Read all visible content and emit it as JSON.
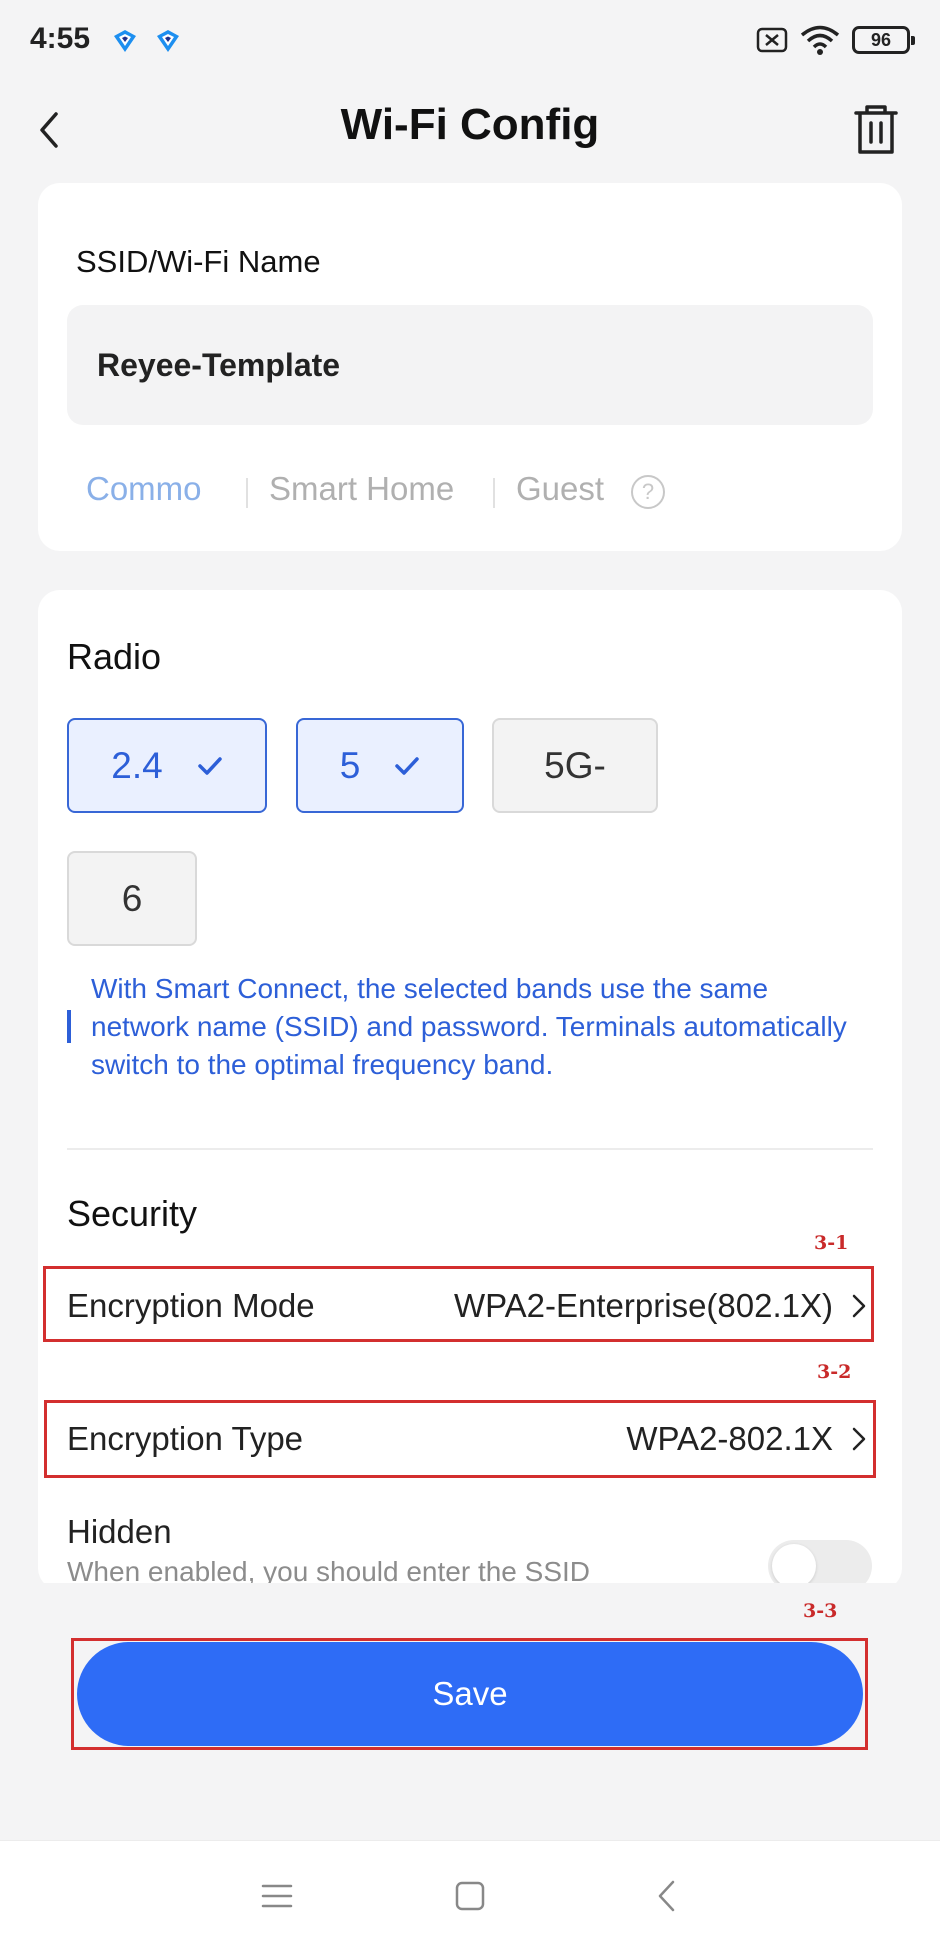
{
  "status_bar": {
    "time": "4:55",
    "battery": "96",
    "icons": [
      "app-notification-icon",
      "app-notification-icon",
      "sim-off-icon",
      "wifi-icon",
      "battery-icon"
    ]
  },
  "header": {
    "title": "Wi-Fi Config",
    "back_icon": "chevron-left-icon",
    "delete_icon": "trash-icon"
  },
  "ssid": {
    "label": "SSID/Wi-Fi Name",
    "value": "Reyee-Template",
    "types": [
      {
        "label": "Commo",
        "active": true
      },
      {
        "label": "Smart Home",
        "active": false
      },
      {
        "label": "Guest",
        "active": false
      }
    ],
    "help_icon": "?"
  },
  "radio": {
    "title": "Radio",
    "bands": [
      {
        "label": "2.4",
        "selected": true
      },
      {
        "label": "5",
        "selected": true
      },
      {
        "label": "5G-",
        "selected": false
      },
      {
        "label": "6",
        "selected": false
      }
    ],
    "hint": "With Smart Connect, the selected bands use the same network name (SSID) and password. Terminals automatically switch to the optimal frequency band."
  },
  "security": {
    "title": "Security",
    "encryption_mode": {
      "label": "Encryption Mode",
      "value": "WPA2-Enterprise(802.1X)",
      "tag": "3-1"
    },
    "encryption_type": {
      "label": "Encryption Type",
      "value": "WPA2-802.1X",
      "tag": "3-2"
    },
    "hidden": {
      "label": "Hidden",
      "description": "When enabled, you should enter the SSID",
      "enabled": false
    }
  },
  "save": {
    "label": "Save",
    "tag": "3-3"
  },
  "colors": {
    "accent": "#2e6cf6",
    "selected_band_bg": "#eaf0ff",
    "annotation_red": "#d32f2f"
  }
}
